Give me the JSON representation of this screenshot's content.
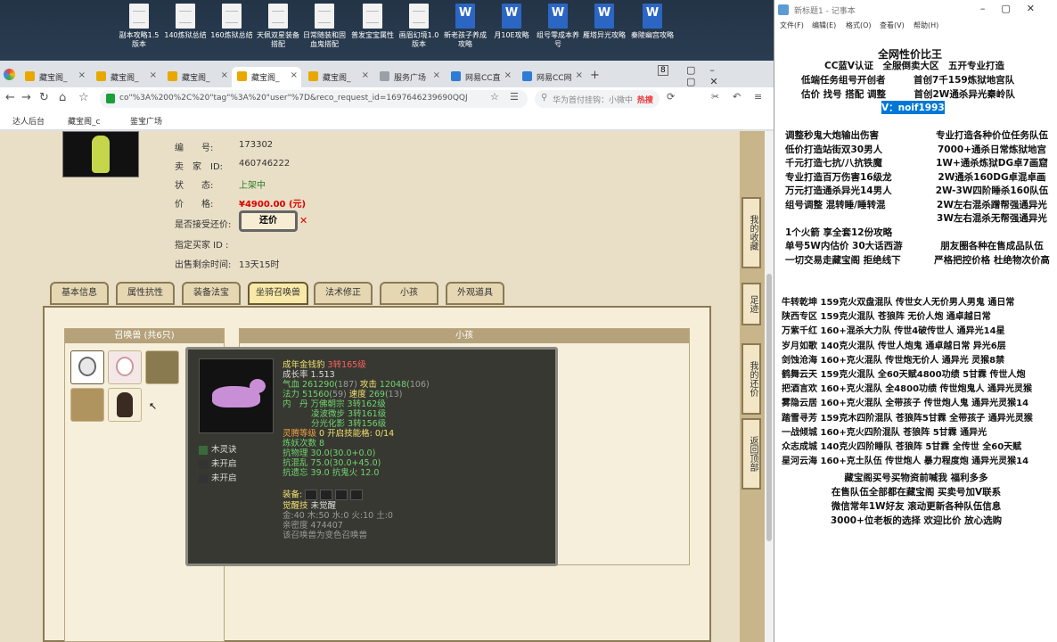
{
  "desktop": {
    "icons": [
      {
        "label": "副本攻略1.5版本",
        "type": "doc"
      },
      {
        "label": "140炼狱总结",
        "type": "doc"
      },
      {
        "label": "160炼狱总结",
        "type": "doc"
      },
      {
        "label": "天佩双星装备搭配",
        "type": "doc"
      },
      {
        "label": "日常随装和固血鬼搭配",
        "type": "doc"
      },
      {
        "label": "普发宝宝属性",
        "type": "doc"
      },
      {
        "label": "画眉幻境1.0版本",
        "type": "doc"
      },
      {
        "label": "新老孩子养成攻略",
        "type": "word"
      },
      {
        "label": "月10E攻略",
        "type": "word"
      },
      {
        "label": "组号零成本养号",
        "type": "word"
      },
      {
        "label": "雁塔异光攻略",
        "type": "word"
      },
      {
        "label": "秦陵幽宫攻略",
        "type": "word"
      }
    ]
  },
  "browser": {
    "tabs": [
      {
        "label": "藏宝阁_"
      },
      {
        "label": "藏宝阁_"
      },
      {
        "label": "藏宝阁_"
      },
      {
        "label": "藏宝阁_",
        "active": true
      },
      {
        "label": "藏宝阁_"
      },
      {
        "label": "服务广场"
      },
      {
        "label": "网易CC直"
      },
      {
        "label": "网易CC网"
      }
    ],
    "tab_count": "8",
    "url": "co\"%3A%200%2C%20\"tag\"%3A%20\"user\"%7D&reco_request_id=1697646239690QQJ",
    "search_placeholder": "华为首付挂钩：小微中",
    "search_hot": "热搜",
    "bookmarks": [
      "达人后台",
      "藏宝阁_c",
      "鉴宝广场"
    ]
  },
  "listing": {
    "fields": [
      {
        "label": "编　　号:",
        "value": "173302"
      },
      {
        "label": "卖　家　ID:",
        "value": "460746222"
      },
      {
        "label": "状　　态:",
        "value": "上架中"
      },
      {
        "label": "价　　格:",
        "value": "¥4900.00 (元)"
      },
      {
        "label": "是否接受还价:",
        "value": ""
      },
      {
        "label": "指定买家 ID :",
        "value": ""
      },
      {
        "label": "出售剩余时间:",
        "value": "13天15时"
      }
    ],
    "counter_offer_button": "还价",
    "tabs": [
      "基本信息",
      "属性抗性",
      "装备法宝",
      "坐骑召唤兽",
      "法术修正",
      "小孩",
      "外观道具"
    ],
    "active_tab": "坐骑召唤兽",
    "pet_box_title": "召唤兽 (共6只)",
    "detail_box_title": "小孩"
  },
  "tooltip": {
    "name": "成年金钱豹",
    "level": "3转165级",
    "growth": "成长率 1.513",
    "hp": "气血 261290(",
    "hp_extra": "187)",
    "atk_label": "攻击",
    "atk": "12048(",
    "atk_extra": "106)",
    "mp": "法力 51560(",
    "mp_extra": "59)",
    "spd_label": "速度",
    "spd": "269(",
    "spd_extra": "13)",
    "danshu": "内　丹 万佛朝宗 3转162级",
    "danshu2": "凌波微步 3转161级",
    "danshu3": "分光化影 3转156级",
    "spirit": "灵腾等级",
    "spirit_val": "0 开启技能格: 0/14",
    "refine": "炼妖次数 8",
    "res1": "抗物理 30.0(30.0+0.0)",
    "res2": "抗混乱 75.0(30.0+45.0)",
    "res3": "抗遗忘 39.0 抗鬼火 12.0",
    "equip_label": "装备:",
    "awaken_label": "觉醒技",
    "awaken_val": "未觉醒",
    "elements": "金:40 木:50 水:0 火:10 土:0",
    "intimacy": "亲密度 474407",
    "note": "该召唤兽为变色召唤兽",
    "skills": [
      "木灵诀",
      "未开启",
      "未开启"
    ]
  },
  "side_buttons": [
    "我的收藏",
    "足迹",
    "我的还价",
    "返回顶部"
  ],
  "notepad": {
    "title": "新标题1 - 记事本",
    "menu": [
      "文件(F)",
      "编辑(E)",
      "格式(O)",
      "查看(V)",
      "帮助(H)"
    ],
    "header": [
      "全网性价比王",
      "CC蓝V认证　全服倒卖大区　五开专业打造",
      "低端任务组号开创者　　　首创7千159炼狱地宫队",
      "估价 找号 搭配 调整　　　首创2W通杀异光秦岭队"
    ],
    "vline": "V：noif1993",
    "left_col": [
      "调整秒鬼大炮输出伤害",
      "低价打造站街双30男人",
      "千元打造七抗/八抗铁魔",
      "专业打造百万伤害16级龙",
      "万元打造通杀异光14男人",
      "组号调整 混转睡/睡转混",
      "",
      "1个火箭 享全套12份攻略",
      "单号5W内估价 30大话西游",
      "一切交易走藏宝阁 拒绝线下"
    ],
    "right_col": [
      "专业打造各种价位任务队伍",
      "7000+通杀日常炼狱地宫",
      "1W+通杀炼狱DG卓7画窟",
      "2W通杀160DG卓混卓画",
      "2W-3W四阶睡杀160队伍",
      "2W左右混杀蹭帮强通异光",
      "3W左右混杀无帮强通异光",
      "",
      "朋友圈各种在售成品队伍",
      "严格把控价格 杜绝物次价高"
    ],
    "list": [
      "牛转乾坤 159克火双盘混队 传世女人无价男人男鬼 通日常",
      "陕西专区 159克火混队 苍狼阵 无价人炮 通卓越日常",
      "万紫千红 160+混杀大力队 传世4破传世人 通异光14星",
      "岁月如歌 140克火混队 传世人炮鬼 通卓越日常 异光6层",
      "剑蚀沧海 160+克火混队 传世炮无价人 通异光 灵猴8禁",
      "鹤舞云天 159克火混队 全60天赋4800功绩 5甘霖 传世人炮",
      "把酒言欢 160+克火混队 全4800功绩 传世炮鬼人 通异光灵猴",
      "雾隐云居 160+克火混队 全带孩子 传世炮人鬼 通异光灵猴14",
      "踏雪寻芳 159克木四阶混队 苍狼阵5甘霖 全带孩子 通异光灵猴",
      "一战倾城 160+克火四阶混队 苍狼阵 5甘霖 通异光",
      "众志成城 140克火四阶睡队 苍狼阵 5甘霖 全传世 全60天赋",
      "星河云海 160+克土队伍 传世炮人 暴力程度炮 通异光灵猴14"
    ],
    "footer": [
      "藏宝阁买号买物资前喊我 福利多多",
      "在售队伍全部都在藏宝阁 买卖号加V联系",
      "微信常年1W好友 滚动更新各种队伍信息",
      "3000+位老板的选择 欢迎比价 放心选购"
    ]
  }
}
